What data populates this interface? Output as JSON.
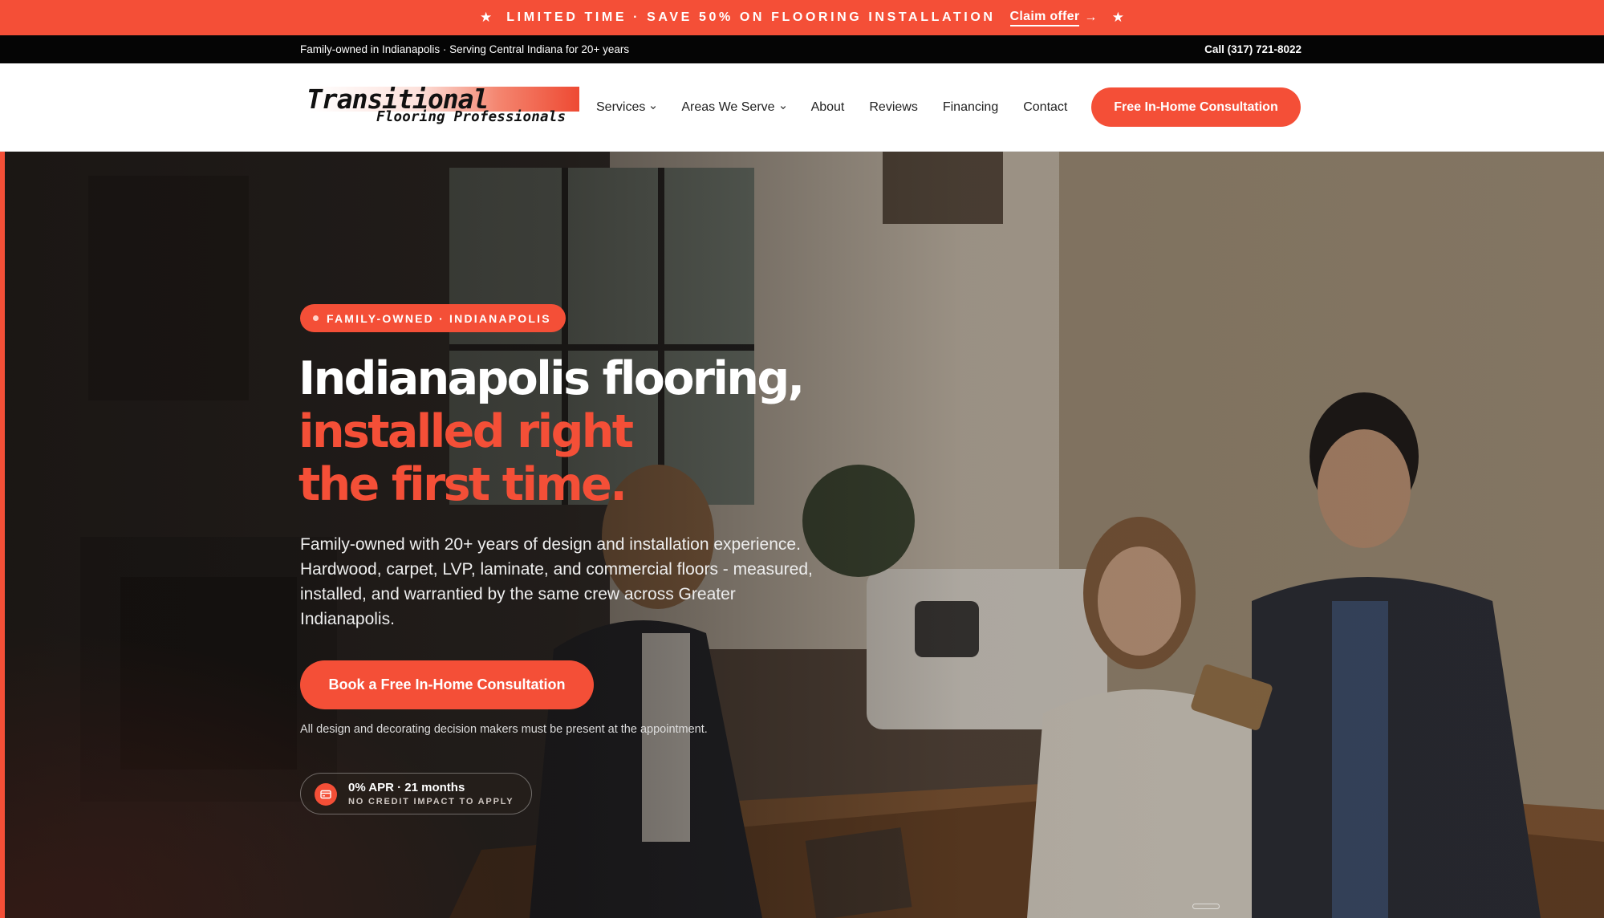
{
  "promo": {
    "text": "LIMITED TIME · SAVE 50% ON FLOORING INSTALLATION",
    "claim_label": "Claim offer",
    "star_glyph": "★",
    "arrow_glyph": "→"
  },
  "utility": {
    "tagline": "Family-owned in Indianapolis · Serving Central Indiana for 20+ years",
    "phone_label": "Call (317) 721-8022"
  },
  "logo": {
    "line1": "Transitional",
    "line2": "Flooring Professionals"
  },
  "nav": {
    "items": [
      {
        "label": "Services",
        "dropdown": true
      },
      {
        "label": "Areas We Serve",
        "dropdown": true
      },
      {
        "label": "About",
        "dropdown": false
      },
      {
        "label": "Reviews",
        "dropdown": false
      },
      {
        "label": "Financing",
        "dropdown": false
      },
      {
        "label": "Contact",
        "dropdown": false
      }
    ],
    "cta_label": "Free In-Home Consultation"
  },
  "hero": {
    "badge": "FAMILY-OWNED · INDIANAPOLIS",
    "headline_line1": "Indianapolis flooring,",
    "headline_line2": "installed right",
    "headline_line3": "the first time.",
    "lede": "Family-owned with 20+ years of design and installation experience. Hardwood, carpet, LVP, laminate, and commercial floors - measured, installed, and warrantied by the same crew across Greater Indianapolis.",
    "cta_label": "Book a Free In-Home Consultation",
    "note": "All design and decorating decision makers must be present at the appointment.",
    "financing_title": "0% APR · 21 months",
    "financing_sub": "NO CREDIT IMPACT TO APPLY"
  },
  "colors": {
    "accent": "#f44f37",
    "utility_bg": "#050505",
    "nav_bg": "#ffffff"
  },
  "icons": {
    "nav_dropdown": "chevron-down-icon",
    "financing": "credit-card-icon",
    "promo_star": "star-icon",
    "promo_arrow": "arrow-right-icon"
  }
}
